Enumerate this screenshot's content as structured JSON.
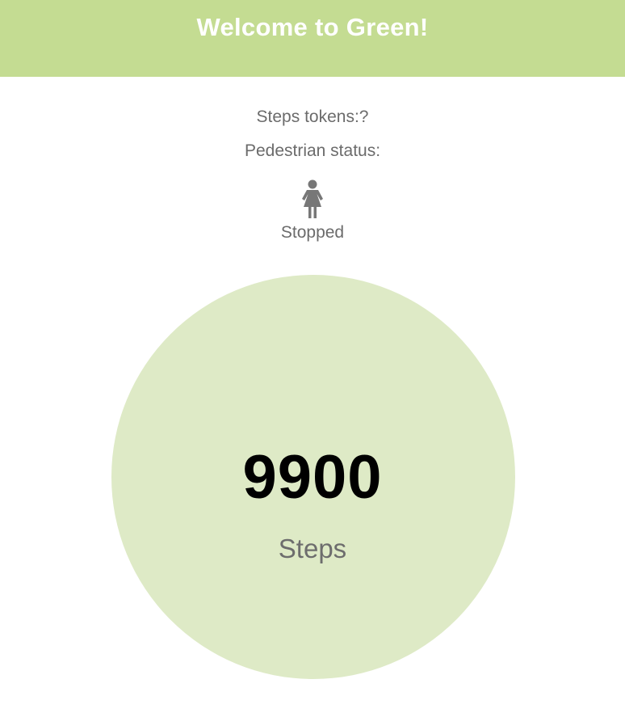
{
  "header": {
    "title": "Welcome to Green!"
  },
  "status": {
    "tokens_label": "Steps tokens:?",
    "pedestrian_label": "Pedestrian status:",
    "pedestrian_icon": "pedestrian-icon",
    "pedestrian_state": "Stopped"
  },
  "counter": {
    "value": "9900",
    "unit": "Steps"
  },
  "colors": {
    "header_bg": "#c4dc92",
    "circle_bg": "#deeac6",
    "text_gray": "#6b6b6b"
  }
}
